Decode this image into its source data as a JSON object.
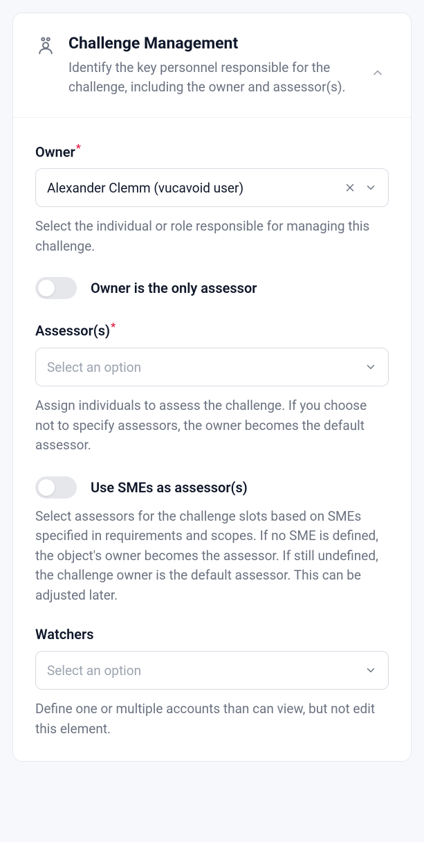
{
  "header": {
    "title": "Challenge Management",
    "subtitle": "Identify the key personnel responsible for the challenge, including the owner and assessor(s)."
  },
  "owner": {
    "label": "Owner",
    "value": "Alexander Clemm (vucavoid user)",
    "help": "Select the individual or role responsible for managing this challenge."
  },
  "owner_only_toggle": {
    "label": "Owner is the only assessor"
  },
  "assessors": {
    "label": "Assessor(s)",
    "placeholder": "Select an option",
    "help": "Assign individuals to assess the challenge. If you choose not to specify assessors, the owner becomes the default assessor."
  },
  "sme_toggle": {
    "label": "Use SMEs as assessor(s)",
    "help": "Select assessors for the challenge slots based on SMEs specified in requirements and scopes. If no SME is defined, the object's owner becomes the assessor. If still undefined, the challenge owner is the default assessor. This can be adjusted later."
  },
  "watchers": {
    "label": "Watchers",
    "placeholder": "Select an option",
    "help": "Define one or multiple accounts than can view, but not edit this element."
  },
  "required_marker": "*"
}
